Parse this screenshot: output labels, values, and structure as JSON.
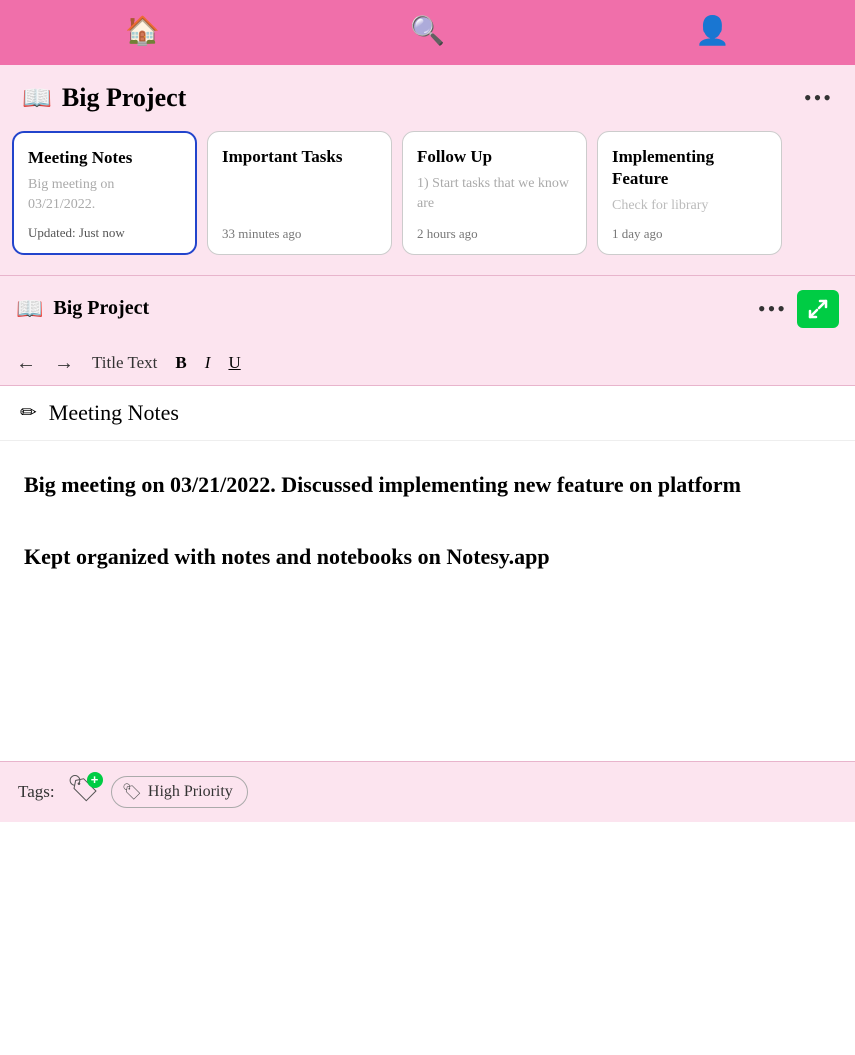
{
  "nav": {
    "home_icon": "🏠",
    "search_icon": "🔍",
    "profile_icon": "👤"
  },
  "project_section": {
    "book_icon": "📖",
    "project_name": "Big Project",
    "more_label": "•••"
  },
  "cards": [
    {
      "title": "Meeting Notes",
      "preview": "Big meeting on 03/21/2022.",
      "updated": "Updated: Just now",
      "selected": true
    },
    {
      "title": "Important Tasks",
      "preview": "",
      "time": "33 minutes ago",
      "selected": false
    },
    {
      "title": "Follow Up",
      "preview": "1) Start tasks that we know are",
      "time": "2 hours ago",
      "selected": false
    },
    {
      "title": "Implementing Feature",
      "preview": "Check for library",
      "time": "1 day ago",
      "selected": false
    }
  ],
  "sub_header": {
    "book_icon": "📖",
    "project_name": "Big Project",
    "more_label": "•••",
    "expand_icon": "⤢"
  },
  "toolbar": {
    "back_label": "←",
    "forward_label": "→",
    "style_label": "Title Text",
    "bold_label": "B",
    "italic_label": "I",
    "underline_label": "U"
  },
  "note": {
    "edit_icon": "✏",
    "title": "Meeting Notes",
    "paragraph1": "Big meeting on 03/21/2022.  Discussed implementing new feature on platform",
    "paragraph2": "Kept organized with notes and notebooks on Notesy.app"
  },
  "tags_footer": {
    "label": "Tags:",
    "tag_icon": "🏷",
    "add_symbol": "+",
    "tag1": {
      "icon": "🏷",
      "label": "High Priority"
    }
  }
}
